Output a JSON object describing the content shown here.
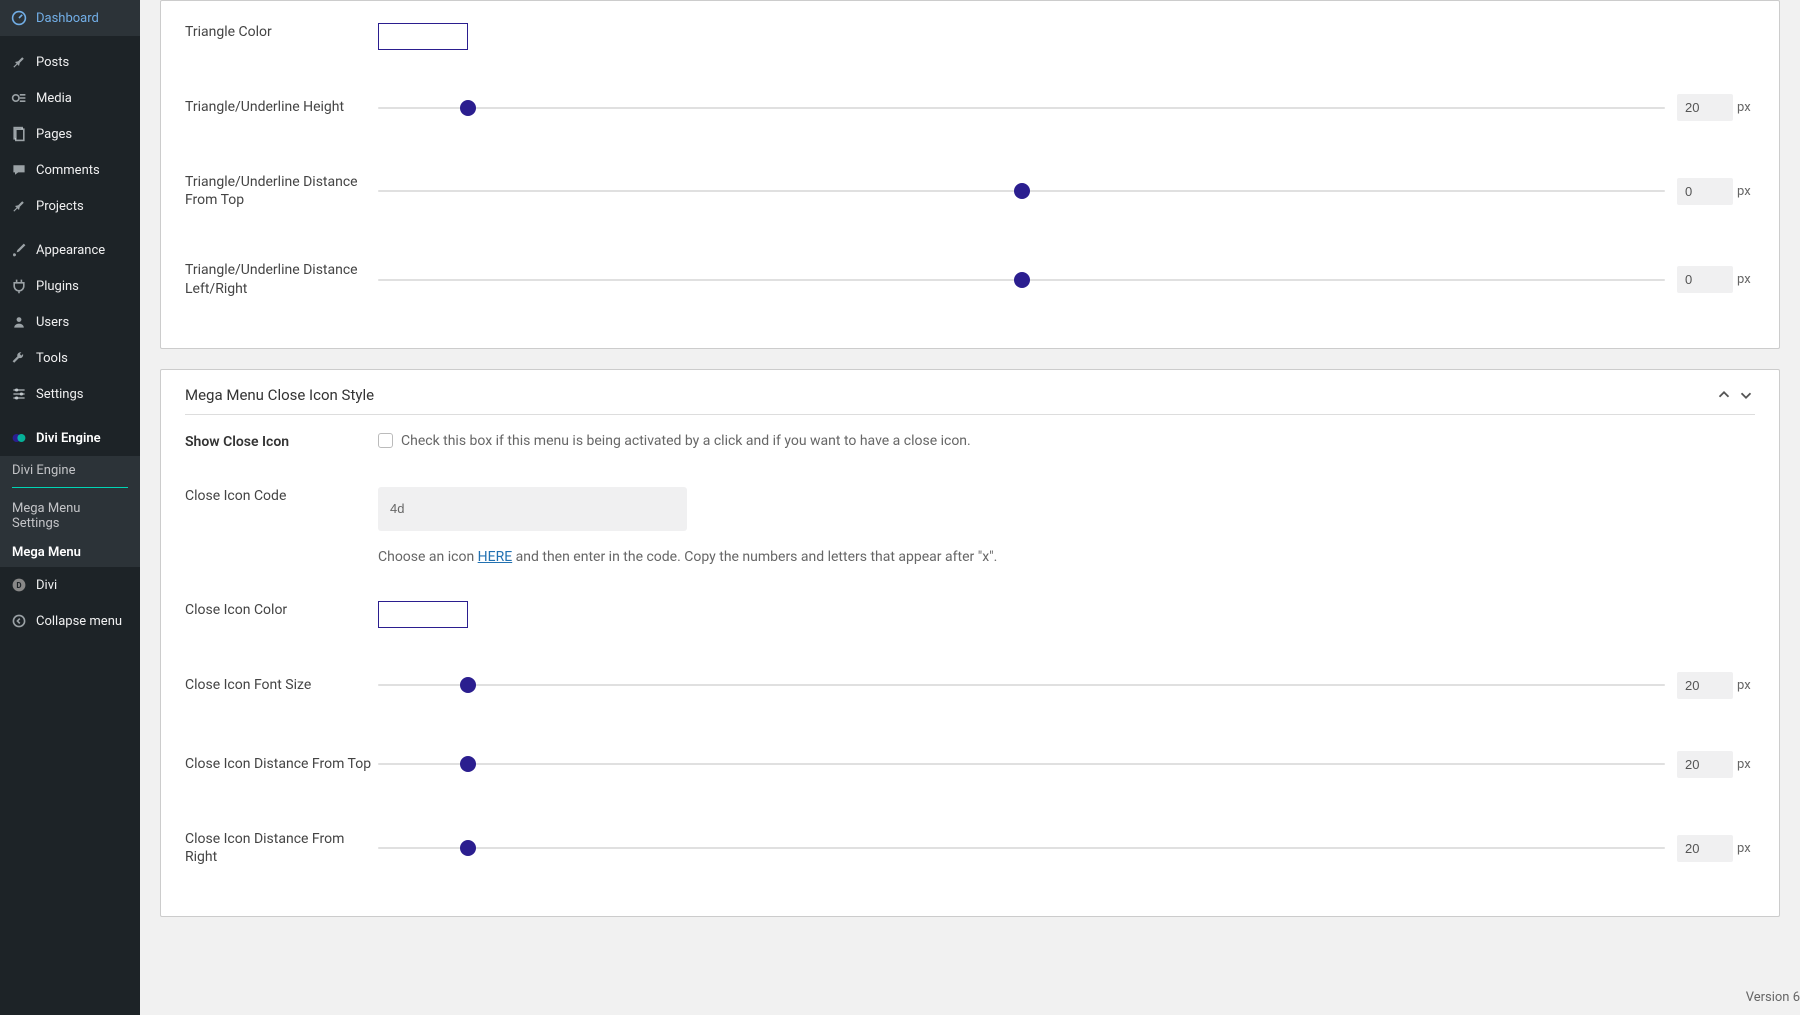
{
  "sidebar": {
    "items": [
      {
        "label": "Dashboard",
        "icon": "dashboard"
      },
      {
        "label": "Posts",
        "icon": "pin"
      },
      {
        "label": "Media",
        "icon": "media"
      },
      {
        "label": "Pages",
        "icon": "page"
      },
      {
        "label": "Comments",
        "icon": "comment"
      },
      {
        "label": "Projects",
        "icon": "pin"
      },
      {
        "label": "Appearance",
        "icon": "brush"
      },
      {
        "label": "Plugins",
        "icon": "plug"
      },
      {
        "label": "Users",
        "icon": "user"
      },
      {
        "label": "Tools",
        "icon": "wrench"
      },
      {
        "label": "Settings",
        "icon": "sliders"
      }
    ],
    "divi_engine": {
      "label": "Divi Engine"
    },
    "submenu": [
      {
        "label": "Divi Engine"
      },
      {
        "label": "Mega Menu Settings"
      },
      {
        "label": "Mega Menu"
      }
    ],
    "divi": {
      "label": "Divi"
    },
    "collapse": {
      "label": "Collapse menu"
    }
  },
  "panel1": {
    "triangle_color": {
      "label": "Triangle Color"
    },
    "triangle_height": {
      "label": "Triangle/Underline Height",
      "value": "20",
      "unit": "px",
      "thumb_pct": 7
    },
    "triangle_top": {
      "label": "Triangle/Underline Distance From Top",
      "value": "0",
      "unit": "px",
      "thumb_pct": 50
    },
    "triangle_lr": {
      "label": "Triangle/Underline Distance Left/Right",
      "value": "0",
      "unit": "px",
      "thumb_pct": 50
    }
  },
  "panel2": {
    "title": "Mega Menu Close Icon Style",
    "show_close": {
      "label": "Show Close Icon",
      "desc": "Check this box if this menu is being activated by a click and if you want to have a close icon."
    },
    "icon_code": {
      "label": "Close Icon Code",
      "value": "4d",
      "help_pre": "Choose an icon ",
      "help_link": "HERE",
      "help_post": " and then enter in the code. Copy the numbers and letters that appear after \"x\"."
    },
    "icon_color": {
      "label": "Close Icon Color"
    },
    "font_size": {
      "label": "Close Icon Font Size",
      "value": "20",
      "unit": "px",
      "thumb_pct": 7
    },
    "dist_top": {
      "label": "Close Icon Distance From Top",
      "value": "20",
      "unit": "px",
      "thumb_pct": 7
    },
    "dist_right": {
      "label": "Close Icon Distance From Right",
      "value": "20",
      "unit": "px",
      "thumb_pct": 7
    }
  },
  "footer": {
    "version": "Version 6"
  }
}
